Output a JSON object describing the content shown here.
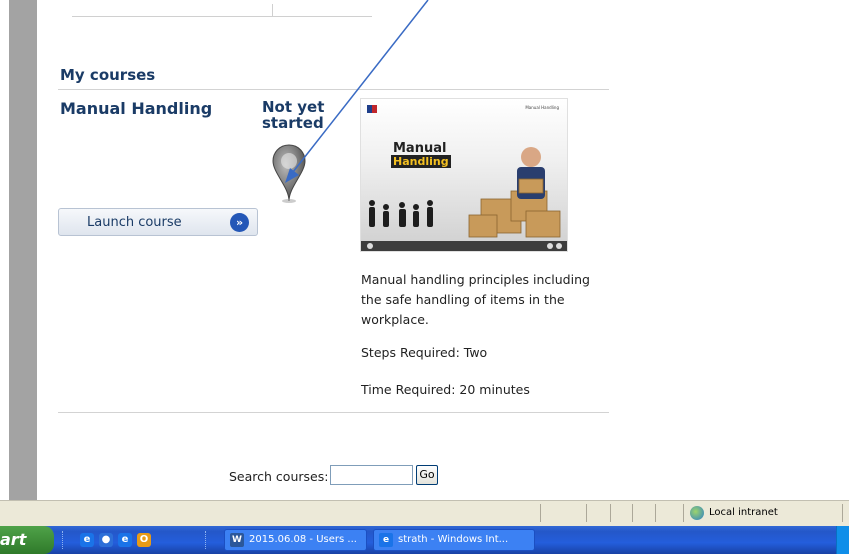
{
  "my_courses": {
    "section_title": "My courses",
    "course": {
      "title": "Manual Handling",
      "status": "Not yet started",
      "launch_label": "Launch course",
      "launch_arrow": "»",
      "thumbnail": {
        "title_line1": "Manual",
        "title_line2": "Handling",
        "corner_label": "Manual Handling"
      },
      "description": "Manual handling principles including the safe handling of items in the workplace.",
      "steps": "Steps Required: Two",
      "time": "Time Required: 20 minutes"
    }
  },
  "search": {
    "label": "Search courses:",
    "value": "",
    "go_label": "Go"
  },
  "statusbar": {
    "zone": "Local intranet"
  },
  "taskbar": {
    "start_label": "art",
    "quick_launch": [
      {
        "name": "ie-icon",
        "glyph": "e",
        "color": "#1a73e8"
      },
      {
        "name": "media-icon",
        "glyph": "●",
        "color": "#2d6fd8"
      },
      {
        "name": "ie-icon",
        "glyph": "e",
        "color": "#1a73e8"
      },
      {
        "name": "outlook-icon",
        "glyph": "O",
        "color": "#e89b17"
      }
    ],
    "tasks": [
      {
        "icon": "W",
        "label": "2015.06.08 - Users ..."
      },
      {
        "icon": "e",
        "label": "strath - Windows Int..."
      }
    ]
  },
  "colors": {
    "heading": "#1a3b66",
    "annotation_arrow": "#3a6bc4"
  }
}
